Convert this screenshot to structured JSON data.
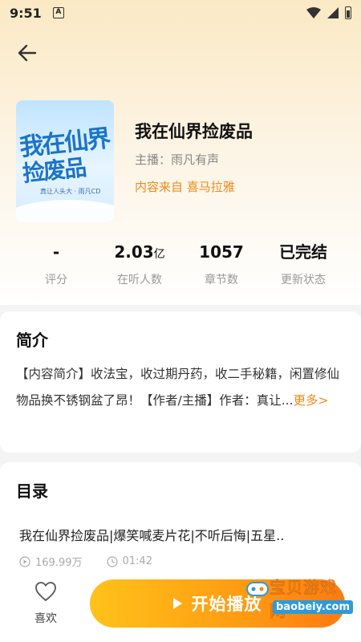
{
  "status_bar": {
    "time": "9:51",
    "a_badge": "A"
  },
  "book": {
    "title": "我在仙界捡废品",
    "host": "主播：雨凡有声",
    "source": "内容来自 喜马拉雅",
    "cover": {
      "title_line1": "我在仙界",
      "title_line2": "捡废品",
      "credits": "真让人头大 · 雨凡CD"
    }
  },
  "stats": [
    {
      "value": "-",
      "unit": "",
      "label": "评分"
    },
    {
      "value": "2.03",
      "unit": "亿",
      "label": "在听人数"
    },
    {
      "value": "1057",
      "unit": "",
      "label": "章节数"
    },
    {
      "value": "已完结",
      "unit": "",
      "label": "更新状态"
    }
  ],
  "intro": {
    "heading": "简介",
    "text": "【内容简介】收法宝，收过期丹药，收二手秘籍，闲置修仙物品换不锈钢盆了昂！【作者/主播】作者：真让...",
    "more": "更多>"
  },
  "toc": {
    "heading": "目录",
    "episodes": [
      {
        "title": "我在仙界捡废品|爆笑喊麦片花|不听后悔|五星..",
        "plays": "169.99万",
        "duration": "01:42"
      }
    ]
  },
  "bottom": {
    "like_label": "喜欢",
    "play_label": "开始播放"
  },
  "watermark": {
    "text": "宝贝游戏网",
    "url": "baobeiy.com"
  },
  "colors": {
    "accent": "#f08a1a",
    "play_start": "#ffc21a",
    "play_end": "#ff7a12"
  }
}
